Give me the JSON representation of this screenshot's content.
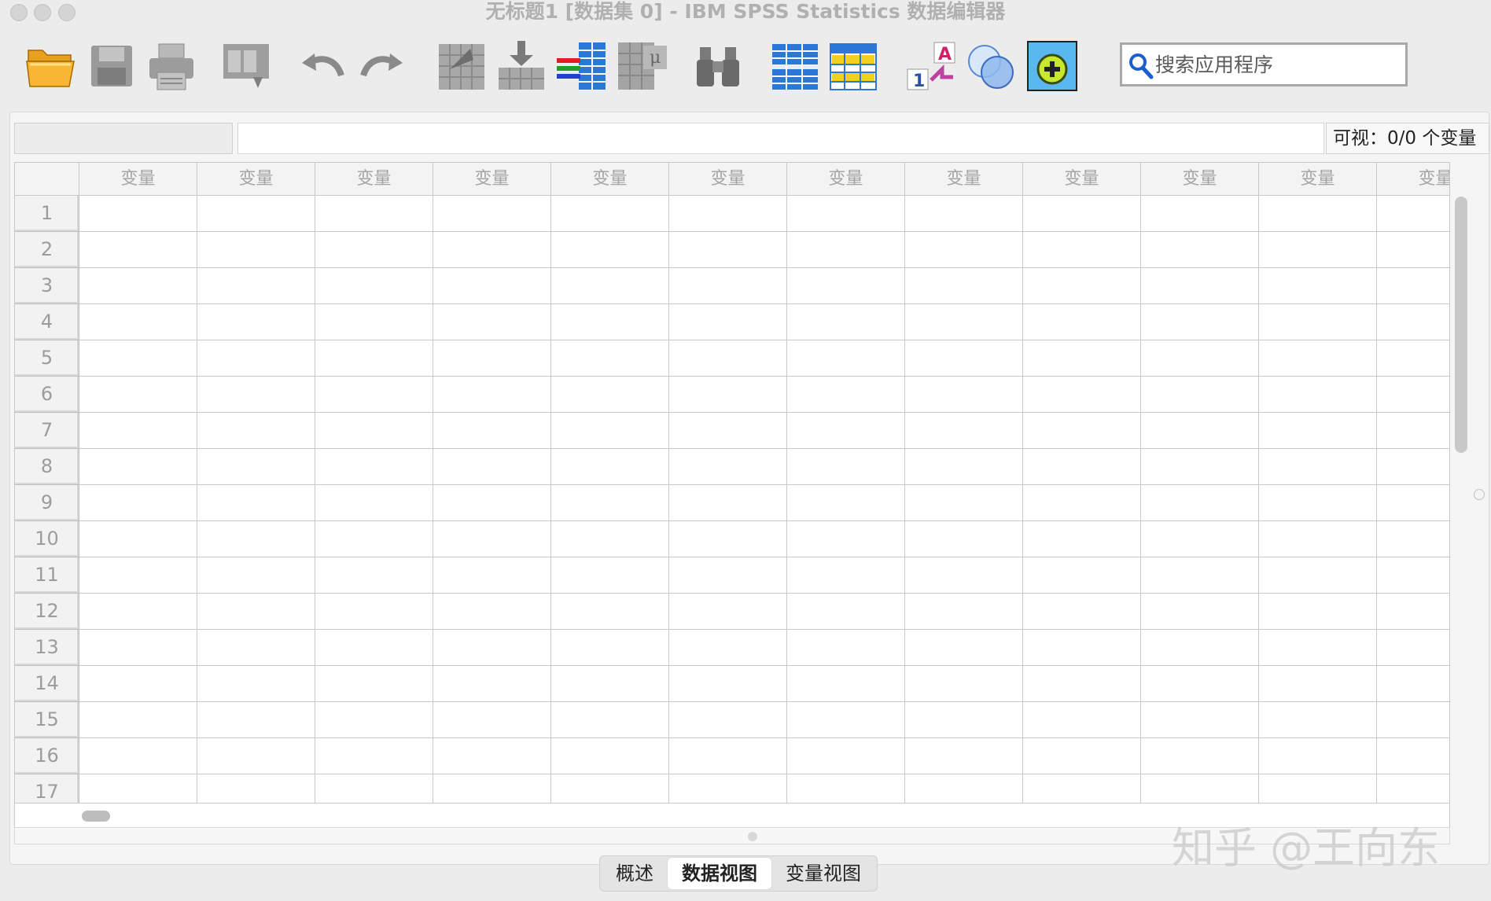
{
  "window": {
    "title": "无标题1 [数据集 0] - IBM SPSS Statistics 数据编辑器"
  },
  "toolbar": {
    "buttons": [
      {
        "name": "open",
        "icon": "folder-open-icon"
      },
      {
        "name": "save",
        "icon": "floppy-disk-icon"
      },
      {
        "name": "print",
        "icon": "printer-icon"
      },
      {
        "name": "recall-dialog",
        "icon": "dialog-recall-icon"
      },
      {
        "name": "undo",
        "icon": "undo-arrow-icon"
      },
      {
        "name": "redo",
        "icon": "redo-arrow-icon"
      },
      {
        "name": "go-to-case",
        "icon": "goto-case-icon"
      },
      {
        "name": "go-to-variable",
        "icon": "goto-variable-icon"
      },
      {
        "name": "variables",
        "icon": "variables-icon"
      },
      {
        "name": "run-descriptive-stats",
        "icon": "descriptives-icon"
      },
      {
        "name": "find",
        "icon": "binoculars-icon"
      },
      {
        "name": "insert-cases",
        "icon": "insert-cases-icon"
      },
      {
        "name": "insert-variable",
        "icon": "insert-variable-icon"
      },
      {
        "name": "value-labels",
        "icon": "value-labels-icon"
      },
      {
        "name": "use-variable-sets",
        "icon": "variable-sets-icon"
      },
      {
        "name": "customize-toolbar",
        "icon": "add-circle-icon"
      }
    ],
    "search_placeholder": "搜索应用程序"
  },
  "status": {
    "visible_label": "可视：0/0 个变量"
  },
  "grid": {
    "column_header": "变量",
    "column_count": 12,
    "row_numbers": [
      "1",
      "2",
      "3",
      "4",
      "5",
      "6",
      "7",
      "8",
      "9",
      "10",
      "11",
      "12",
      "13",
      "14",
      "15",
      "16",
      "17"
    ]
  },
  "tabs": [
    {
      "label": "概述",
      "active": false
    },
    {
      "label": "数据视图",
      "active": true
    },
    {
      "label": "变量视图",
      "active": false
    }
  ],
  "watermark": "知乎 @王向东",
  "colors": {
    "grid_line": "#c8c8c8",
    "header_text": "#a4a4a4",
    "background": "#ececec"
  }
}
